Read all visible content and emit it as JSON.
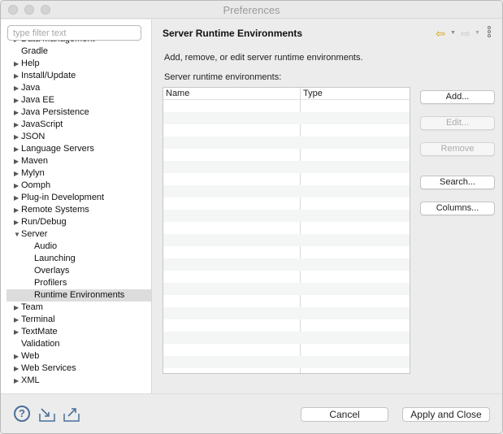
{
  "window": {
    "title": "Preferences"
  },
  "filter": {
    "placeholder": "type filter text",
    "value": ""
  },
  "tree": [
    {
      "label": "Data Management",
      "expandable": true,
      "expanded": false,
      "child": false
    },
    {
      "label": "Gradle",
      "expandable": false,
      "child": false
    },
    {
      "label": "Help",
      "expandable": true,
      "expanded": false,
      "child": false
    },
    {
      "label": "Install/Update",
      "expandable": true,
      "expanded": false,
      "child": false
    },
    {
      "label": "Java",
      "expandable": true,
      "expanded": false,
      "child": false
    },
    {
      "label": "Java EE",
      "expandable": true,
      "expanded": false,
      "child": false
    },
    {
      "label": "Java Persistence",
      "expandable": true,
      "expanded": false,
      "child": false
    },
    {
      "label": "JavaScript",
      "expandable": true,
      "expanded": false,
      "child": false
    },
    {
      "label": "JSON",
      "expandable": true,
      "expanded": false,
      "child": false
    },
    {
      "label": "Language Servers",
      "expandable": true,
      "expanded": false,
      "child": false
    },
    {
      "label": "Maven",
      "expandable": true,
      "expanded": false,
      "child": false
    },
    {
      "label": "Mylyn",
      "expandable": true,
      "expanded": false,
      "child": false
    },
    {
      "label": "Oomph",
      "expandable": true,
      "expanded": false,
      "child": false
    },
    {
      "label": "Plug-in Development",
      "expandable": true,
      "expanded": false,
      "child": false
    },
    {
      "label": "Remote Systems",
      "expandable": true,
      "expanded": false,
      "child": false
    },
    {
      "label": "Run/Debug",
      "expandable": true,
      "expanded": false,
      "child": false
    },
    {
      "label": "Server",
      "expandable": true,
      "expanded": true,
      "child": false
    },
    {
      "label": "Audio",
      "expandable": false,
      "child": true
    },
    {
      "label": "Launching",
      "expandable": false,
      "child": true
    },
    {
      "label": "Overlays",
      "expandable": false,
      "child": true
    },
    {
      "label": "Profilers",
      "expandable": false,
      "child": true
    },
    {
      "label": "Runtime Environments",
      "expandable": false,
      "child": true,
      "selected": true
    },
    {
      "label": "Team",
      "expandable": true,
      "expanded": false,
      "child": false
    },
    {
      "label": "Terminal",
      "expandable": true,
      "expanded": false,
      "child": false
    },
    {
      "label": "TextMate",
      "expandable": true,
      "expanded": false,
      "child": false
    },
    {
      "label": "Validation",
      "expandable": false,
      "child": false
    },
    {
      "label": "Web",
      "expandable": true,
      "expanded": false,
      "child": false
    },
    {
      "label": "Web Services",
      "expandable": true,
      "expanded": false,
      "child": false
    },
    {
      "label": "XML",
      "expandable": true,
      "expanded": false,
      "child": false
    }
  ],
  "panel": {
    "title": "Server Runtime Environments",
    "description": "Add, remove, or edit server runtime environments.",
    "table_label": "Server runtime environments:",
    "columns": [
      "Name",
      "Type"
    ],
    "rows": []
  },
  "buttons": {
    "add": "Add...",
    "edit": "Edit...",
    "remove": "Remove",
    "search": "Search...",
    "columns": "Columns..."
  },
  "footer": {
    "help_glyph": "?",
    "cancel": "Cancel",
    "apply_close": "Apply and Close"
  },
  "icons": {
    "back": "back-arrow-icon",
    "forward": "forward-arrow-icon",
    "menu": "view-menu-icon",
    "help": "help-icon",
    "import": "import-icon",
    "export": "export-icon"
  },
  "colors": {
    "nav_arrow": "#d4a11a",
    "help_blue": "#4a6f99",
    "selection": "#dcdcdc"
  }
}
